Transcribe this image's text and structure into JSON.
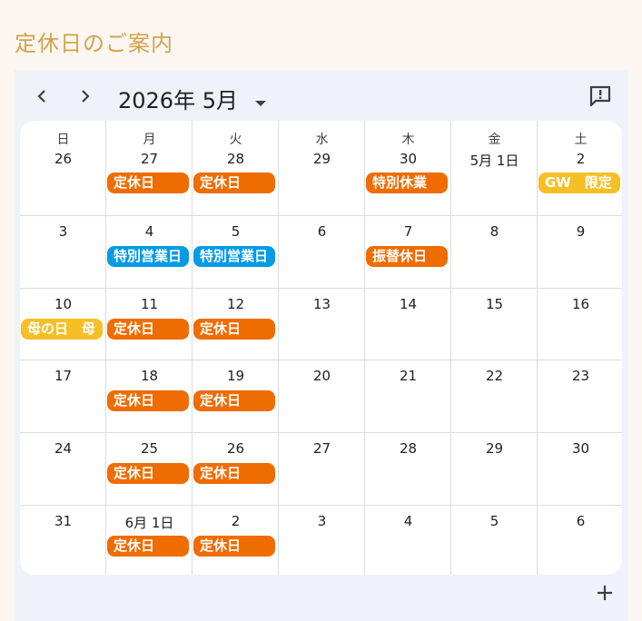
{
  "page": {
    "title": "定休日のご案内"
  },
  "toolbar": {
    "month_label": "2026年 5月"
  },
  "colors": {
    "orange": "#ef6c00",
    "blue": "#039be5",
    "yellow": "#f6bf26",
    "title": "#d4a34a"
  },
  "weekdays": [
    "日",
    "月",
    "火",
    "水",
    "木",
    "金",
    "土"
  ],
  "weeks": [
    {
      "days": [
        "26",
        "27",
        "28",
        "29",
        "30",
        "5月 1日",
        "2"
      ],
      "events": [
        {
          "col": 1,
          "span": 1,
          "label": "定休日",
          "color": "orange"
        },
        {
          "col": 2,
          "span": 1,
          "label": "定休日",
          "color": "orange"
        },
        {
          "col": 4,
          "span": 1,
          "label": "特別休業",
          "color": "orange"
        },
        {
          "col": 6,
          "span": 1,
          "label": "GW　限定",
          "color": "yellow"
        }
      ]
    },
    {
      "days": [
        "3",
        "4",
        "5",
        "6",
        "7",
        "8",
        "9"
      ],
      "events": [
        {
          "col": 1,
          "span": 1,
          "label": "特別営業日",
          "color": "blue"
        },
        {
          "col": 2,
          "span": 1,
          "label": "特別営業日",
          "color": "blue"
        },
        {
          "col": 4,
          "span": 1,
          "label": "振替休日",
          "color": "orange"
        }
      ]
    },
    {
      "days": [
        "10",
        "11",
        "12",
        "13",
        "14",
        "15",
        "16"
      ],
      "events": [
        {
          "col": 0,
          "span": 1,
          "label": "母の日　母",
          "color": "yellow"
        },
        {
          "col": 1,
          "span": 1,
          "label": "定休日",
          "color": "orange"
        },
        {
          "col": 2,
          "span": 1,
          "label": "定休日",
          "color": "orange"
        }
      ]
    },
    {
      "days": [
        "17",
        "18",
        "19",
        "20",
        "21",
        "22",
        "23"
      ],
      "events": [
        {
          "col": 1,
          "span": 1,
          "label": "定休日",
          "color": "orange"
        },
        {
          "col": 2,
          "span": 1,
          "label": "定休日",
          "color": "orange"
        }
      ]
    },
    {
      "days": [
        "24",
        "25",
        "26",
        "27",
        "28",
        "29",
        "30"
      ],
      "events": [
        {
          "col": 1,
          "span": 1,
          "label": "定休日",
          "color": "orange"
        },
        {
          "col": 2,
          "span": 1,
          "label": "定休日",
          "color": "orange"
        }
      ]
    },
    {
      "days": [
        "31",
        "6月 1日",
        "2",
        "3",
        "4",
        "5",
        "6"
      ],
      "events": [
        {
          "col": 1,
          "span": 1,
          "label": "定休日",
          "color": "orange"
        },
        {
          "col": 2,
          "span": 1,
          "label": "定休日",
          "color": "orange"
        }
      ]
    }
  ]
}
